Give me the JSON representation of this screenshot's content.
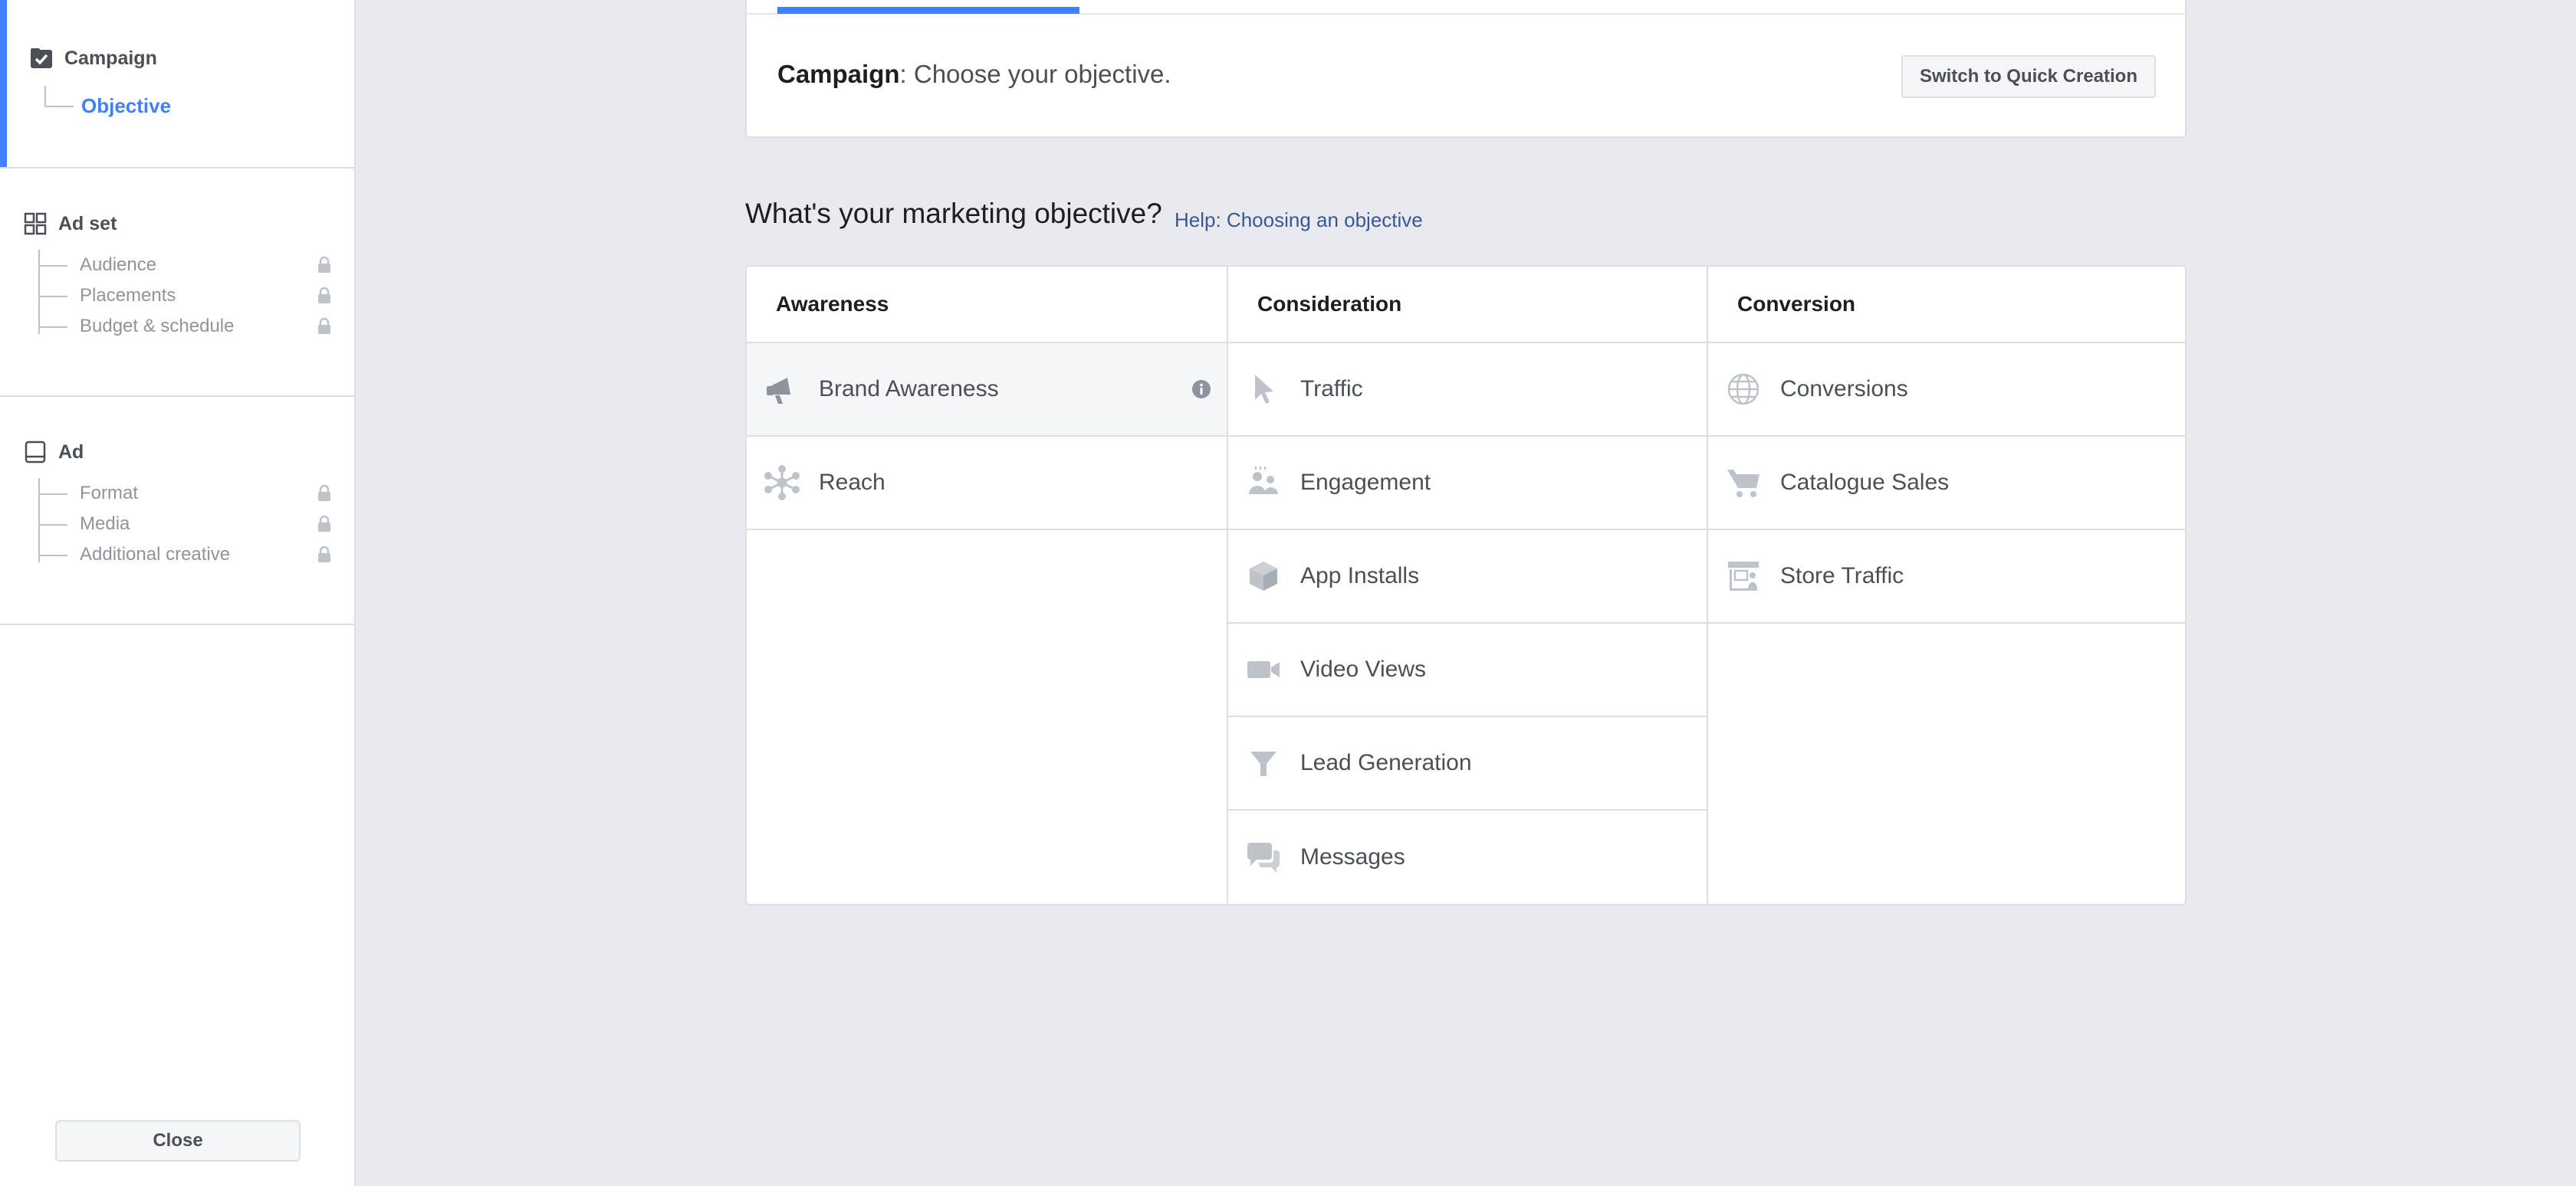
{
  "sidebar": {
    "campaign": {
      "title": "Campaign",
      "items": [
        "Objective"
      ]
    },
    "adset": {
      "title": "Ad set",
      "items": [
        "Audience",
        "Placements",
        "Budget & schedule"
      ]
    },
    "ad": {
      "title": "Ad",
      "items": [
        "Format",
        "Media",
        "Additional creative"
      ]
    },
    "close_label": "Close"
  },
  "header": {
    "title_bold": "Campaign",
    "title_rest": ": Choose your objective.",
    "quick_creation_label": "Switch to Quick Creation"
  },
  "question": "What's your marketing objective?",
  "help_link": "Help: Choosing an objective",
  "columns": [
    {
      "title": "Awareness",
      "items": [
        {
          "label": "Brand Awareness",
          "icon": "megaphone-icon"
        },
        {
          "label": "Reach",
          "icon": "reach-icon"
        }
      ]
    },
    {
      "title": "Consideration",
      "items": [
        {
          "label": "Traffic",
          "icon": "cursor-icon"
        },
        {
          "label": "Engagement",
          "icon": "people-icon"
        },
        {
          "label": "App Installs",
          "icon": "box-icon"
        },
        {
          "label": "Video Views",
          "icon": "video-camera-icon"
        },
        {
          "label": "Lead Generation",
          "icon": "funnel-icon"
        },
        {
          "label": "Messages",
          "icon": "chat-bubbles-icon"
        }
      ]
    },
    {
      "title": "Conversion",
      "items": [
        {
          "label": "Conversions",
          "icon": "globe-icon"
        },
        {
          "label": "Catalogue Sales",
          "icon": "cart-icon"
        },
        {
          "label": "Store Traffic",
          "icon": "store-icon"
        }
      ]
    }
  ],
  "colors": {
    "accent": "#4080ff",
    "link": "#365899",
    "icon": "#bec3c9",
    "background": "#e9eaed"
  }
}
